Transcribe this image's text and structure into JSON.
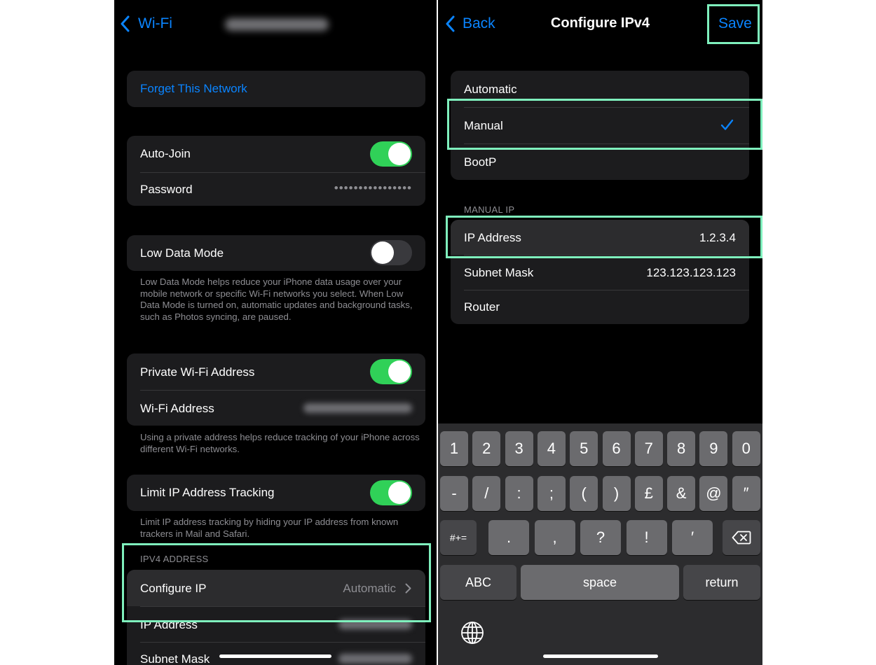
{
  "left": {
    "nav": {
      "back_label": "Wi-Fi"
    },
    "forget_label": "Forget This Network",
    "auto_join": {
      "label": "Auto-Join",
      "on": true
    },
    "password": {
      "label": "Password",
      "value": "••••••••••••••••"
    },
    "low_data": {
      "label": "Low Data Mode",
      "on": false,
      "footer": "Low Data Mode helps reduce your iPhone data usage over your mobile network or specific Wi-Fi networks you select. When Low Data Mode is turned on, automatic updates and background tasks, such as Photos syncing, are paused."
    },
    "private_address": {
      "label": "Private Wi-Fi Address",
      "on": true
    },
    "wifi_address": {
      "label": "Wi-Fi Address"
    },
    "private_footer": "Using a private address helps reduce tracking of your iPhone across different Wi-Fi networks.",
    "limit_ip": {
      "label": "Limit IP Address Tracking",
      "on": true,
      "footer": "Limit IP address tracking by hiding your IP address from known trackers in Mail and Safari."
    },
    "ipv4_header": "IPV4 ADDRESS",
    "configure_ip": {
      "label": "Configure IP",
      "value": "Automatic"
    },
    "ip_address_label": "IP Address",
    "subnet_mask_label": "Subnet Mask"
  },
  "right": {
    "nav": {
      "back_label": "Back",
      "title": "Configure IPv4",
      "save_label": "Save"
    },
    "modes": [
      {
        "label": "Automatic",
        "selected": false
      },
      {
        "label": "Manual",
        "selected": true
      },
      {
        "label": "BootP",
        "selected": false
      }
    ],
    "manual_header": "MANUAL IP",
    "fields": [
      {
        "label": "IP Address",
        "value": "1.2.3.4"
      },
      {
        "label": "Subnet Mask",
        "value": "123.123.123.123"
      },
      {
        "label": "Router",
        "value": ""
      }
    ],
    "keyboard": {
      "row1": [
        "1",
        "2",
        "3",
        "4",
        "5",
        "6",
        "7",
        "8",
        "9",
        "0"
      ],
      "row2": [
        "-",
        "/",
        ":",
        ";",
        "(",
        ")",
        "£",
        "&",
        "@",
        "″"
      ],
      "row3": [
        ".",
        ",",
        "?",
        "!",
        "′"
      ],
      "symbols_label": "#+=",
      "abc_label": "ABC",
      "space_label": "space",
      "return_label": "return"
    }
  },
  "colors": {
    "accent": "#0a84ff",
    "toggle_on": "#30d158",
    "highlight": "#7ff0bd"
  },
  "icons": [
    "chevron-left-icon",
    "checkmark-icon",
    "chevron-right-icon",
    "delete-key-icon",
    "globe-icon"
  ]
}
